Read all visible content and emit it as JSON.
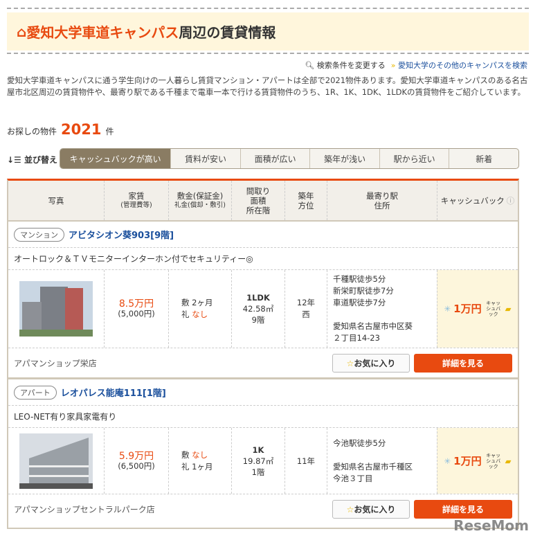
{
  "header": {
    "title_highlight": "愛知大学車道キャンパス",
    "title_rest": "周辺の賃貸情報"
  },
  "links": {
    "change": "検索条件を変更する",
    "other": "愛知大学のその他のキャンパスを検索"
  },
  "intro": "愛知大学車道キャンパスに通う学生向けの一人暮らし賃貸マンション・アパートは全部で2021物件あります。愛知大学車道キャンパスのある名古屋市北区周辺の賃貸物件や、最寄り駅である千種まで電車一本で行ける賃貸物件のうち、1R、1K、1DK、1LDKの賃貸物件をご紹介しています。",
  "count": {
    "label": "お探しの物件",
    "value": "2021",
    "unit": "件"
  },
  "sort": {
    "label": "並び替え",
    "options": [
      "キャッシュバックが高い",
      "賃料が安い",
      "面積が広い",
      "築年が浅い",
      "駅から近い",
      "新着"
    ]
  },
  "columns": {
    "photo": "写真",
    "rent": "家賃",
    "rent_sub": "(管理費等)",
    "deposit": "敷金(保証金)",
    "key": "礼金(償却・敷引)",
    "layout1": "間取り",
    "layout2": "面積",
    "layout3": "所在階",
    "age1": "築年",
    "age2": "方位",
    "station1": "最寄り駅",
    "station2": "住所",
    "cashback": "キャッシュバック"
  },
  "listings": [
    {
      "type": "マンション",
      "name": "アビタシオン葵903[9階]",
      "desc": "オートロック＆ＴＶモニターインターホン付でセキュリティー◎",
      "rent": "8.5万円",
      "fee": "(5,000円)",
      "deposit_label": "敷",
      "deposit": "2ヶ月",
      "key_label": "礼",
      "key": "なし",
      "layout": "1LDK",
      "area": "42.58㎡",
      "floor": "9階",
      "age": "12年",
      "direction": "西",
      "stations": [
        "千種駅徒歩5分",
        "新栄町駅徒歩7分",
        "車道駅徒歩7分"
      ],
      "address": [
        "愛知県名古屋市中区葵",
        "２丁目14-23"
      ],
      "cashback": "1万円",
      "cashback_tag": "キャッシュバック",
      "shop": "アパマンショップ栄店",
      "fav": "お気に入り",
      "detail": "詳細を見る"
    },
    {
      "type": "アパート",
      "name": "レオパレス能庵111[1階]",
      "desc": "LEO-NET有り家具家電有り",
      "rent": "5.9万円",
      "fee": "(6,500円)",
      "deposit_label": "敷",
      "deposit": "なし",
      "key_label": "礼",
      "key": "1ヶ月",
      "layout": "1K",
      "area": "19.87㎡",
      "floor": "1階",
      "age": "11年",
      "direction": "",
      "stations": [
        "今池駅徒歩5分"
      ],
      "address": [
        "愛知県名古屋市千種区",
        "今池３丁目"
      ],
      "cashback": "1万円",
      "cashback_tag": "キャッシュバック",
      "shop": "アパマンショップセントラルパーク店",
      "fav": "お気に入り",
      "detail": "詳細を見る"
    }
  ],
  "watermark": "ReseMom",
  "colors": {
    "accent": "#e84a10",
    "link": "#1a4f9c",
    "banner": "#fff6dc"
  }
}
